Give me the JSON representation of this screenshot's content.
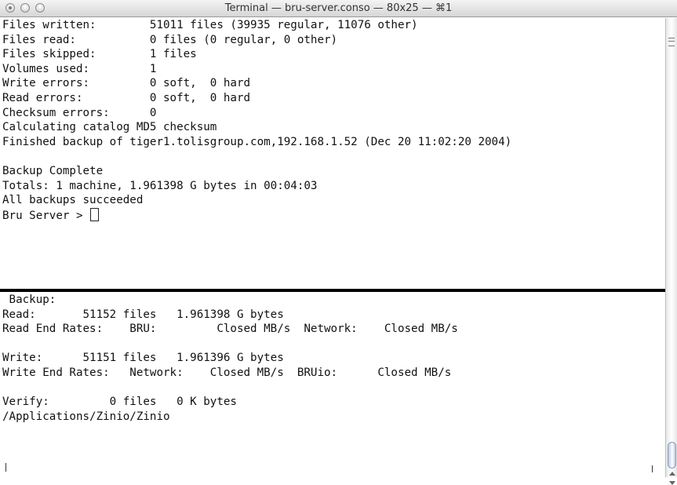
{
  "window": {
    "title": "Terminal — bru-server.conso — 80x25 — ⌘1"
  },
  "top_pane": {
    "lines": [
      "Files written:        51011 files (39935 regular, 11076 other)",
      "Files read:           0 files (0 regular, 0 other)",
      "Files skipped:        1 files",
      "Volumes used:         1",
      "Write errors:         0 soft,  0 hard",
      "Read errors:          0 soft,  0 hard",
      "Checksum errors:      0",
      "Calculating catalog MD5 checksum",
      "Finished backup of tiger1.tolisgroup.com,192.168.1.52 (Dec 20 11:02:20 2004)",
      "",
      "Backup Complete",
      "Totals: 1 machine, 1.961398 G bytes in 00:04:03",
      "All backups succeeded"
    ],
    "prompt": "Bru Server > "
  },
  "bottom_pane": {
    "lines": [
      " Backup:",
      "Read:       51152 files   1.961398 G bytes",
      "Read End Rates:    BRU:         Closed MB/s  Network:    Closed MB/s",
      "",
      "Write:      51151 files   1.961396 G bytes",
      "Write End Rates:   Network:    Closed MB/s  BRUio:      Closed MB/s",
      "",
      "Verify:         0 files   0 K bytes",
      "/Applications/Zinio/Zinio"
    ]
  }
}
